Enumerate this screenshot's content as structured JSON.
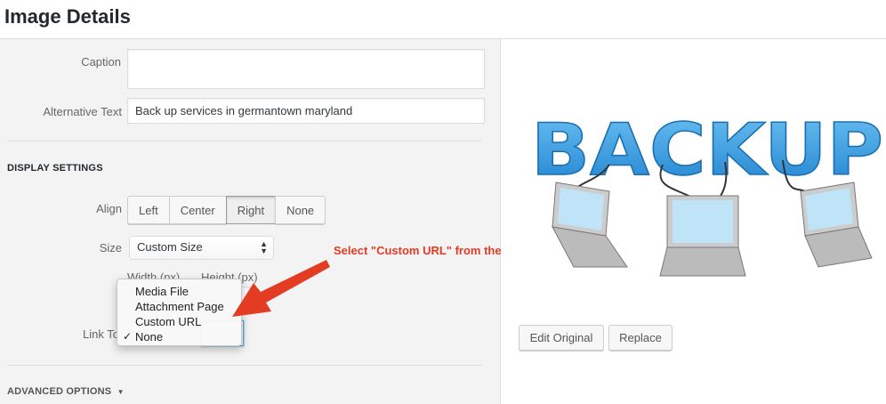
{
  "header": {
    "title": "Image Details"
  },
  "form": {
    "caption_label": "Caption",
    "caption_value": "",
    "alt_label": "Alternative Text",
    "alt_value": "Back up services in germantown maryland",
    "display_settings_title": "DISPLAY SETTINGS",
    "align_label": "Align",
    "align_options": [
      "Left",
      "Center",
      "Right",
      "None"
    ],
    "align_selected": "Right",
    "size_label": "Size",
    "size_value": "Custom Size",
    "width_label": "Width (px)",
    "height_label": "Height (px)",
    "link_to_label": "Link To",
    "link_dropdown": {
      "options": [
        "Media File",
        "Attachment Page",
        "Custom URL",
        "None"
      ],
      "checked": "None",
      "check_glyph": "✓"
    },
    "advanced_options": "ADVANCED OPTIONS",
    "advanced_arrow": "▼"
  },
  "annotation": {
    "text": "Select \"Custom URL\" from the dropdown",
    "color": "#e43b23"
  },
  "preview": {
    "image_word": "BACKUP",
    "edit_original_label": "Edit Original",
    "replace_label": "Replace"
  },
  "colors": {
    "accent": "#e43b23",
    "backup_blue": "#3a9ee0"
  }
}
